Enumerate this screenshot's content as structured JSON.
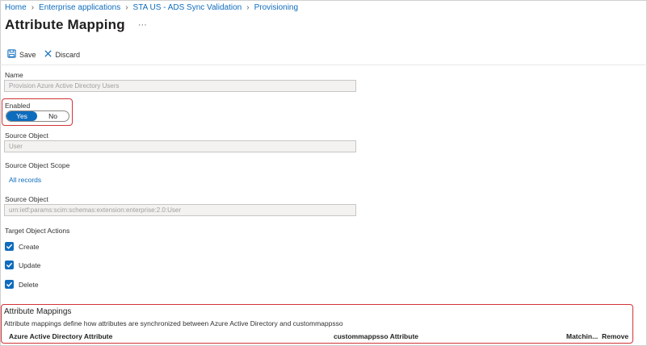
{
  "breadcrumb": {
    "items": [
      "Home",
      "Enterprise applications",
      "STA US - ADS Sync Validation",
      "Provisioning"
    ]
  },
  "header": {
    "title": "Attribute Mapping",
    "more": "···"
  },
  "toolbar": {
    "save_label": "Save",
    "discard_label": "Discard",
    "icons": [
      "save-icon",
      "close-icon"
    ]
  },
  "form": {
    "name_label": "Name",
    "name_value": "Provision Azure Active Directory Users",
    "enabled_label": "Enabled",
    "enabled_yes": "Yes",
    "enabled_no": "No",
    "enabled_selected": "Yes",
    "source_object_label": "Source Object",
    "source_object_value": "User",
    "source_scope_label": "Source Object Scope",
    "source_scope_link": "All records",
    "target_object_label": "Source Object",
    "target_object_value": "urn:ietf:params:scim:schemas:extension:enterprise:2.0:User",
    "target_actions_label": "Target Object Actions",
    "actions": [
      {
        "label": "Create",
        "checked": true
      },
      {
        "label": "Update",
        "checked": true
      },
      {
        "label": "Delete",
        "checked": true
      }
    ]
  },
  "attribute_mappings": {
    "title": "Attribute Mappings",
    "description": "Attribute mappings define how attributes are synchronized between Azure Active Directory and custommappsso",
    "columns": [
      "Azure Active Directory Attribute",
      "custommappsso Attribute",
      "Matchin...",
      "Remove"
    ]
  },
  "colors": {
    "accent": "#0f6cbd",
    "highlight": "#d13438",
    "text": "#323130"
  }
}
